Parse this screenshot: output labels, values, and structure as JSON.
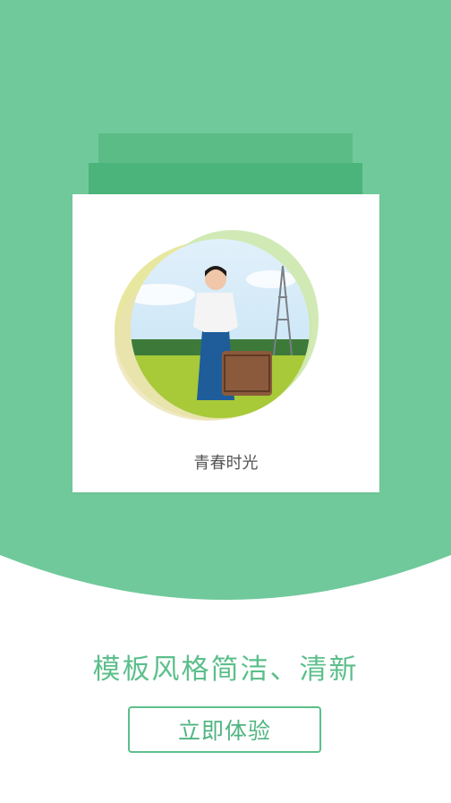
{
  "colors": {
    "hero_background": "#70c99b",
    "stack_back": "#5bbd85",
    "stack_mid": "#4bb47a",
    "accent": "#5cbf8b",
    "card": "#ffffff"
  },
  "card": {
    "caption": "青春时光"
  },
  "main": {
    "headline": "模板风格简洁、清新",
    "cta_label": "立即体验"
  }
}
